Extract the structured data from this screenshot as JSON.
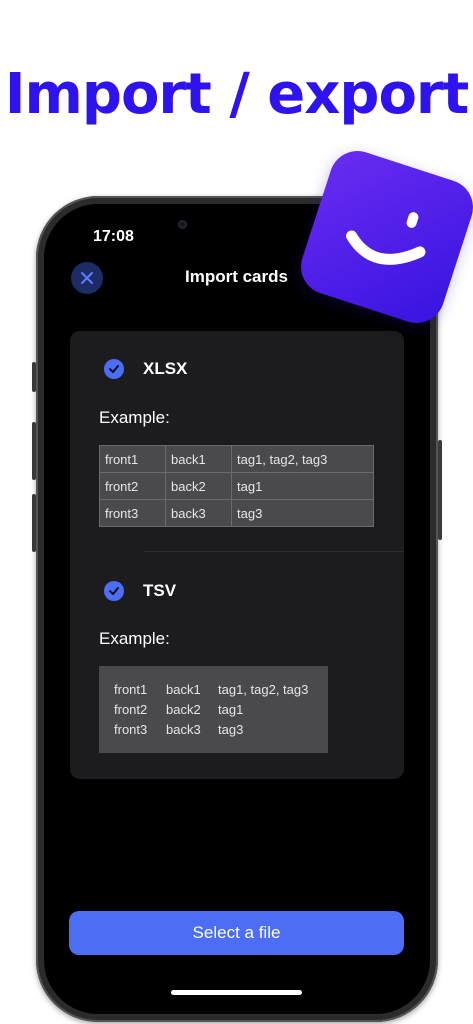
{
  "headline": "Import / export",
  "status_bar": {
    "time": "17:08"
  },
  "nav": {
    "title": "Import cards",
    "close_icon": "close-icon"
  },
  "formats": [
    {
      "name": "XLSX",
      "selected": true,
      "example_label": "Example:",
      "rows": [
        [
          "front1",
          "back1",
          "tag1, tag2, tag3"
        ],
        [
          "front2",
          "back2",
          "tag1"
        ],
        [
          "front3",
          "back3",
          "tag3"
        ]
      ]
    },
    {
      "name": "TSV",
      "selected": true,
      "example_label": "Example:",
      "rows": [
        [
          "front1",
          "back1",
          "tag1, tag2, tag3"
        ],
        [
          "front2",
          "back2",
          "tag1"
        ],
        [
          "front3",
          "back3",
          "tag3"
        ]
      ]
    }
  ],
  "primary_button": {
    "label": "Select a file"
  },
  "colors": {
    "headline": "#2f12f0",
    "accent": "#4b6ef5",
    "card": "#1c1c1e",
    "logo": "#5a24ee"
  }
}
